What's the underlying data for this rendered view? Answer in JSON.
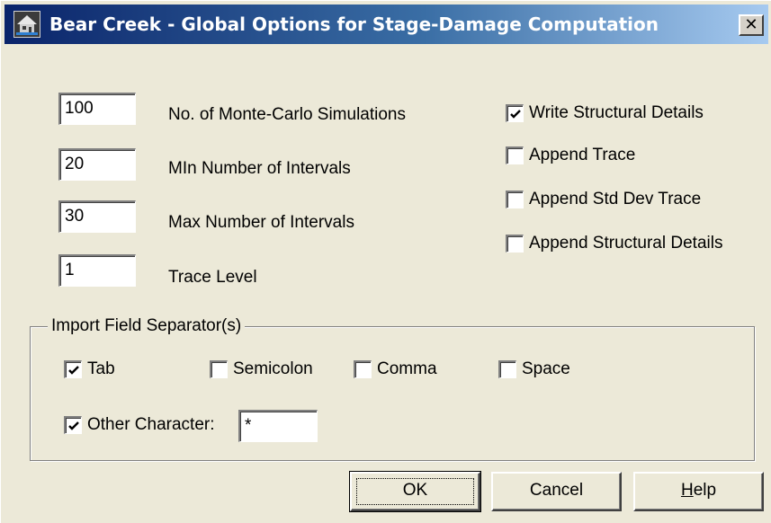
{
  "window": {
    "title": "Bear Creek - Global Options for Stage-Damage Computation",
    "close_label": "x"
  },
  "fields": [
    {
      "value": "100",
      "label": "No. of Monte-Carlo Simulations"
    },
    {
      "value": "20",
      "label": "MIn Number of Intervals"
    },
    {
      "value": "30",
      "label": "Max Number of Intervals"
    },
    {
      "value": "1",
      "label": "Trace Level"
    }
  ],
  "options": [
    {
      "label": "Write Structural Details",
      "checked": true
    },
    {
      "label": "Append Trace",
      "checked": false
    },
    {
      "label": "Append Std Dev Trace",
      "checked": false
    },
    {
      "label": "Append Structural Details",
      "checked": false
    }
  ],
  "separators": {
    "title": "Import Field Separator(s)",
    "tab": {
      "label": "Tab",
      "checked": true
    },
    "semicolon": {
      "label": "Semicolon",
      "checked": false
    },
    "comma": {
      "label": "Comma",
      "checked": false
    },
    "space": {
      "label": "Space",
      "checked": false
    },
    "other": {
      "label": "Other Character:",
      "checked": true,
      "value": "*"
    }
  },
  "buttons": {
    "ok": "OK",
    "cancel": "Cancel",
    "help": "Help"
  }
}
